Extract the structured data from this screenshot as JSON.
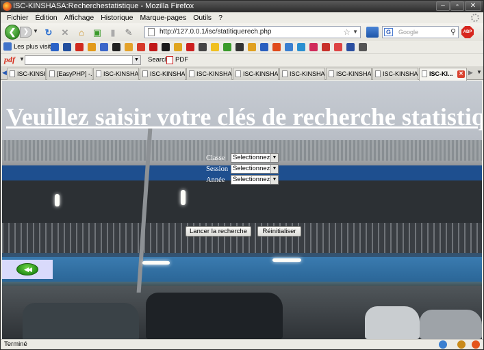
{
  "window": {
    "title": "ISC-KINSHASA:Recherchestatistique - Mozilla Firefox",
    "controls": {
      "minimize": "–",
      "maximize": "▫",
      "close": "✕"
    }
  },
  "menubar": {
    "items": [
      "Fichier",
      "Édition",
      "Affichage",
      "Historique",
      "Marque-pages",
      "Outils",
      "?"
    ]
  },
  "navbar": {
    "url": "http://127.0.0.1/isc/statitiquerech.php",
    "search_placeholder": "Google",
    "search_engine_letter": "G",
    "adblock_label": "ABP"
  },
  "bookmarks": {
    "first_label": "Les plus visités"
  },
  "pdfbar": {
    "logo": "pdf",
    "search_label": "Search",
    "pdf_label": "PDF"
  },
  "tabs": [
    {
      "label": "ISC-KINSHA..."
    },
    {
      "label": "[EasyPHP] -..."
    },
    {
      "label": "ISC-KINSHA..."
    },
    {
      "label": "ISC-KINSHA..."
    },
    {
      "label": "ISC-KINSHA..."
    },
    {
      "label": "ISC-KINSHA..."
    },
    {
      "label": "ISC-KINSHA..."
    },
    {
      "label": "ISC-KINSHA..."
    },
    {
      "label": "ISC-KINSHA..."
    },
    {
      "label": "ISC-KI..."
    }
  ],
  "page": {
    "title": "Veuillez saisir votre clés de recherche statistique !",
    "form": {
      "classe_label": "Classe",
      "classe_value": "Selectionnez",
      "session_label": "Session",
      "session_value": "Selectionnez",
      "annee_label": "Année",
      "annee_value": "Selectionnez"
    },
    "search_button": "Lancer la recherche",
    "reset_button": "Réinitialiser"
  },
  "status": {
    "text": "Terminé"
  },
  "colors": {
    "accent_green": "#2f8a22",
    "title_text": "#ffffff",
    "nav_panel": "#d9dafb"
  }
}
